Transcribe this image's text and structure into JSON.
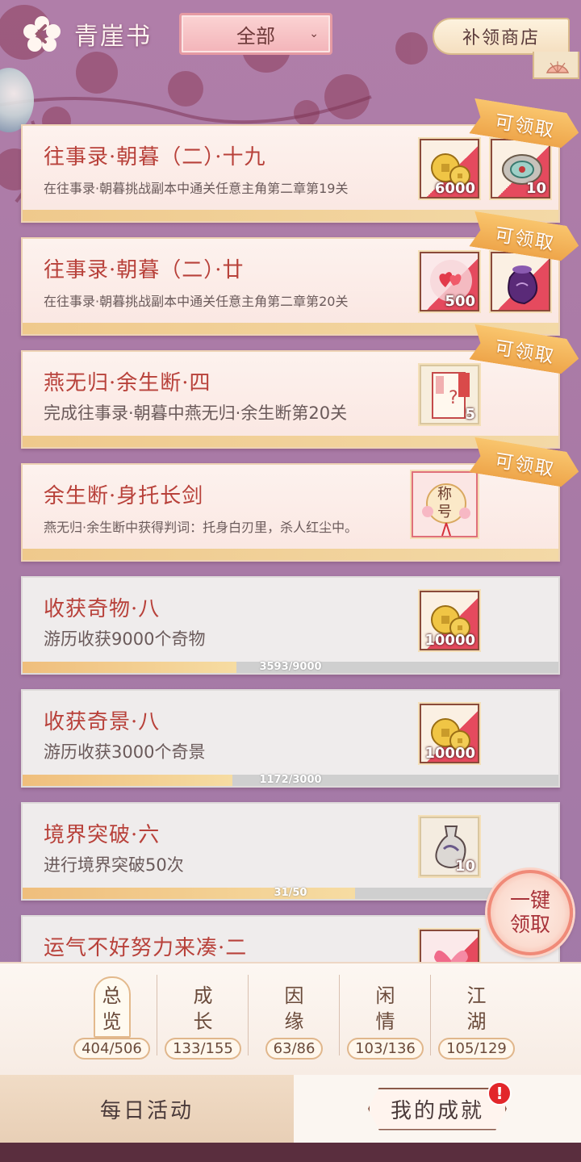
{
  "header": {
    "title": "青崖书",
    "filter_value": "全部",
    "shop_label": "补领商店"
  },
  "tasks": [
    {
      "name": "往事录·朝暮（二）·十九",
      "desc": "在往事录·朝暮挑战副本中通关任意主角第二章第19关",
      "state": "claimable",
      "claim_label": "可领取",
      "rewards": [
        {
          "icon": "coin-icon",
          "count": "6000"
        },
        {
          "icon": "jade-pendant-icon",
          "count": "10"
        }
      ]
    },
    {
      "name": "往事录·朝暮（二）·廿",
      "desc": "在往事录·朝暮挑战副本中通关任意主角第二章第20关",
      "state": "claimable",
      "claim_label": "可领取",
      "rewards": [
        {
          "icon": "heart-icon",
          "count": "500"
        },
        {
          "icon": "purple-pouch-icon",
          "count": ""
        }
      ]
    },
    {
      "name": "燕无归·余生断·四",
      "desc": "完成往事录·朝暮中燕无归·余生断第20关",
      "state": "claimable",
      "claim_label": "可领取",
      "rewards": [
        {
          "icon": "mystery-card-icon",
          "count": "5"
        }
      ]
    },
    {
      "name": "余生断·身托长剑",
      "desc": "燕无归·余生断中获得判词：托身白刃里，杀人红尘中。",
      "state": "claimable",
      "claim_label": "可领取",
      "rewards": [
        {
          "icon": "title-badge-icon",
          "count": "",
          "text": "称号"
        }
      ]
    },
    {
      "name": "收获奇物·八",
      "desc": "游历收获9000个奇物",
      "state": "progress",
      "progress_text": "3593/9000",
      "progress": 0.399,
      "rewards": [
        {
          "icon": "coin-icon",
          "count": "10000"
        }
      ]
    },
    {
      "name": "收获奇景·八",
      "desc": "游历收获3000个奇景",
      "state": "progress",
      "progress_text": "1172/3000",
      "progress": 0.391,
      "rewards": [
        {
          "icon": "coin-icon",
          "count": "10000"
        }
      ]
    },
    {
      "name": "境界突破·六",
      "desc": "进行境界突破50次",
      "state": "progress",
      "progress_text": "31/50",
      "progress": 0.62,
      "rewards": [
        {
          "icon": "porcelain-vase-icon",
          "count": "10"
        }
      ]
    },
    {
      "name": "运气不好努力来凑·二",
      "desc": "",
      "state": "progress",
      "progress_text": "",
      "progress": 0,
      "rewards": [
        {
          "icon": "butterfly-icon",
          "count": ""
        }
      ]
    }
  ],
  "onekey_label_1": "一键",
  "onekey_label_2": "领取",
  "categories": [
    {
      "label_1": "总",
      "label_2": "览",
      "count": "404/506",
      "active": true
    },
    {
      "label_1": "成",
      "label_2": "长",
      "count": "133/155",
      "active": false
    },
    {
      "label_1": "因",
      "label_2": "缘",
      "count": "63/86",
      "active": false
    },
    {
      "label_1": "闲",
      "label_2": "情",
      "count": "103/136",
      "active": false
    },
    {
      "label_1": "江",
      "label_2": "湖",
      "count": "105/129",
      "active": false
    }
  ],
  "bottom_tabs": {
    "daily": "每日活动",
    "mine": "我的成就",
    "alert": "!"
  },
  "colors": {
    "accent_red": "#b8413a",
    "claim_orange": "#eea54a",
    "background": "#a97aa6"
  }
}
